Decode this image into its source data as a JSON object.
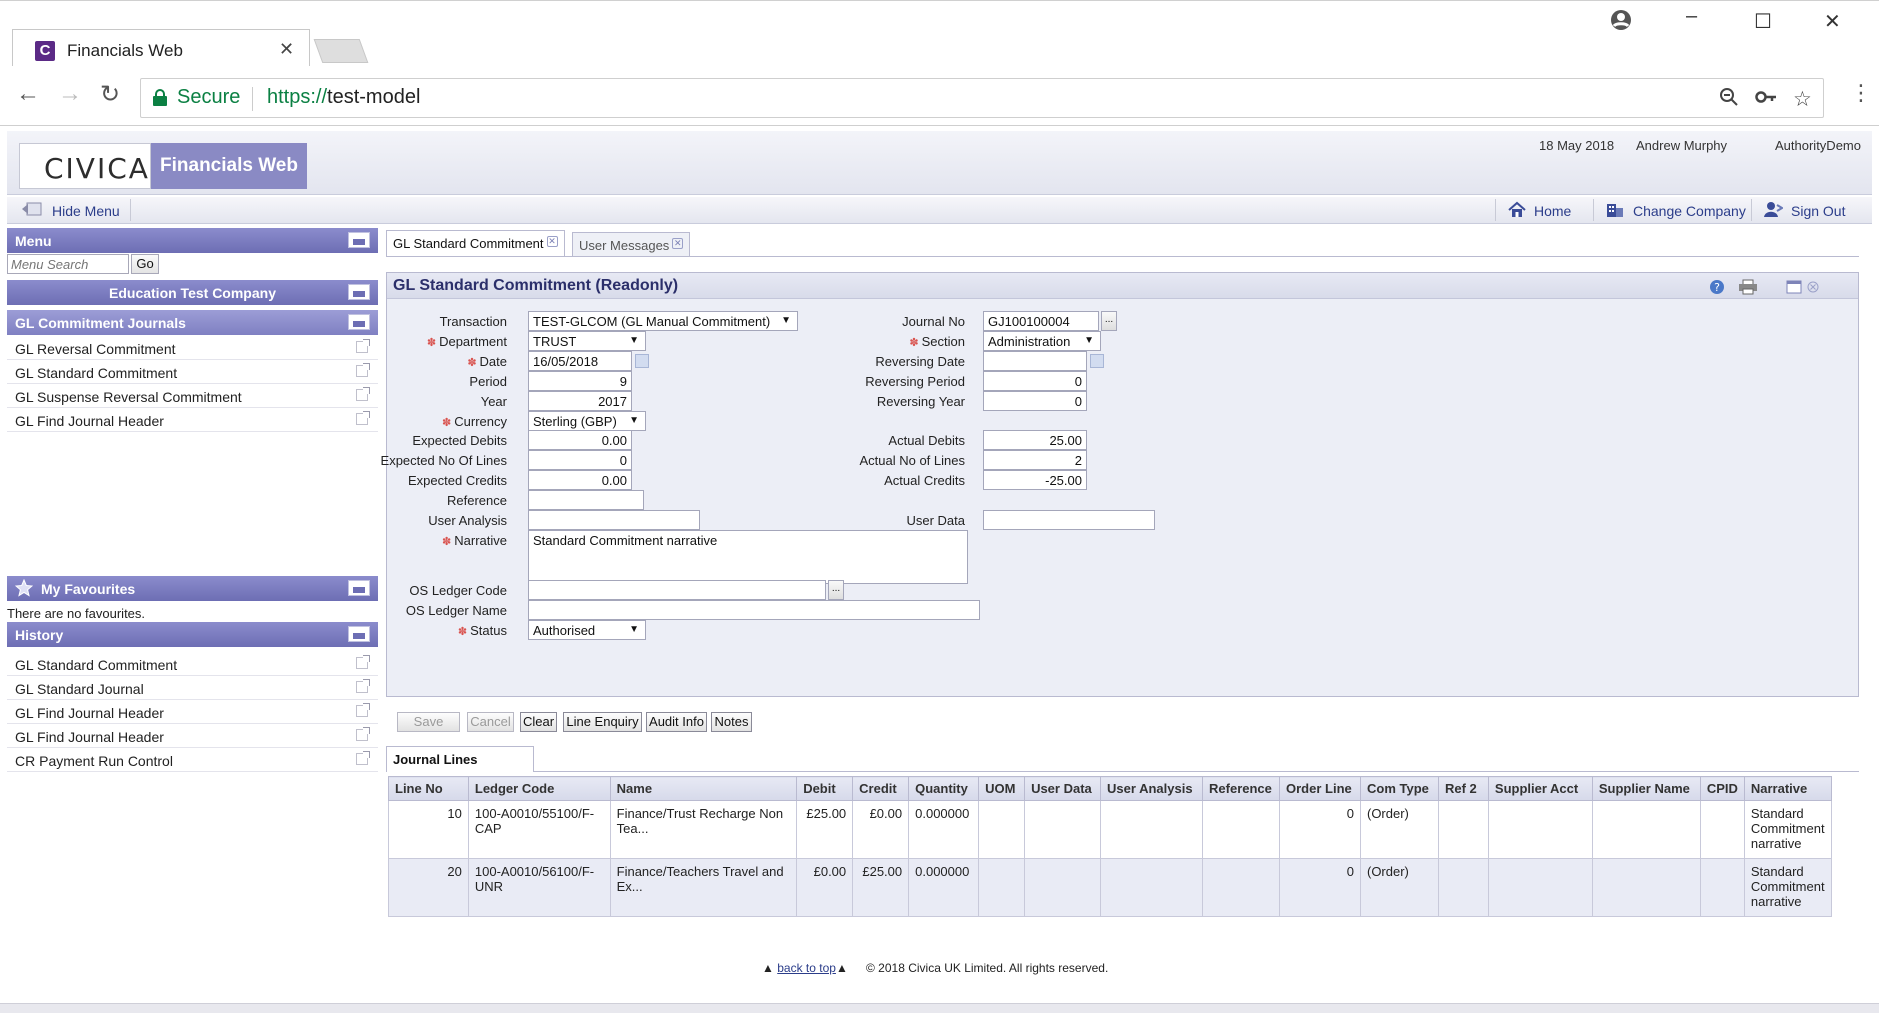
{
  "browser": {
    "tab_title": "Financials Web",
    "secure_label": "Secure",
    "url_scheme": "https://",
    "url_host": "test-model"
  },
  "header": {
    "logo_text": "CIVICA",
    "product_name": "Financials Web",
    "date": "18 May 2018",
    "user": "Andrew Murphy",
    "authority": "AuthorityDemo"
  },
  "menubar": {
    "hide_menu": "Hide Menu",
    "home": "Home",
    "change_company": "Change Company",
    "sign_out": "Sign Out"
  },
  "sidebar": {
    "menu_header": "Menu",
    "search_placeholder": "Menu Search",
    "go_label": "Go",
    "company": "Education Test Company",
    "group_header": "GL Commitment Journals",
    "items": [
      "GL Reversal Commitment",
      "GL Standard Commitment",
      "GL Suspense Reversal Commitment",
      "GL Find Journal Header"
    ],
    "favourites_header": "My Favourites",
    "favourites_empty": "There are no favourites.",
    "history_header": "History",
    "history": [
      "GL Standard Commitment",
      "GL Standard Journal",
      "GL Find Journal Header",
      "GL Find Journal Header",
      "CR Payment Run Control"
    ]
  },
  "tabs": [
    {
      "label": "GL Standard Commitment"
    },
    {
      "label": "User Messages"
    }
  ],
  "form": {
    "title": "GL Standard Commitment (Readonly)",
    "labels": {
      "transaction": "Transaction",
      "department": "Department",
      "date": "Date",
      "period": "Period",
      "year": "Year",
      "currency": "Currency",
      "expected_debits": "Expected Debits",
      "expected_lines": "Expected No Of Lines",
      "expected_credits": "Expected Credits",
      "reference": "Reference",
      "user_analysis": "User Analysis",
      "narrative": "Narrative",
      "os_ledger_code": "OS Ledger Code",
      "os_ledger_name": "OS Ledger Name",
      "status": "Status",
      "journal_no": "Journal No",
      "section": "Section",
      "reversing_date": "Reversing Date",
      "reversing_period": "Reversing Period",
      "reversing_year": "Reversing Year",
      "actual_debits": "Actual Debits",
      "actual_lines": "Actual No of Lines",
      "actual_credits": "Actual Credits",
      "user_data": "User Data"
    },
    "values": {
      "transaction": "TEST-GLCOM (GL Manual Commitment)",
      "department": "TRUST",
      "date": "16/05/2018",
      "period": "9",
      "year": "2017",
      "currency": "Sterling (GBP)",
      "expected_debits": "0.00",
      "expected_lines": "0",
      "expected_credits": "0.00",
      "reference": "",
      "user_analysis": "",
      "narrative": "Standard Commitment narrative",
      "os_ledger_code": "",
      "os_ledger_name": "",
      "status": "Authorised",
      "journal_no": "GJ100100004",
      "section": "Administration",
      "reversing_date": "",
      "reversing_period": "0",
      "reversing_year": "0",
      "actual_debits": "25.00",
      "actual_lines": "2",
      "actual_credits": "-25.00",
      "user_data": ""
    }
  },
  "buttons": {
    "save": "Save",
    "cancel": "Cancel",
    "clear": "Clear",
    "line_enquiry": "Line Enquiry",
    "audit_info": "Audit Info",
    "notes": "Notes"
  },
  "journal_lines": {
    "tab_label": "Journal Lines",
    "columns": [
      "Line No",
      "Ledger Code",
      "Name",
      "Debit",
      "Credit",
      "Quantity",
      "UOM",
      "User Data",
      "User Analysis",
      "Reference",
      "Order Line",
      "Com Type",
      "Ref 2",
      "Supplier Acct",
      "Supplier Name",
      "CPID",
      "Narrative"
    ],
    "rows": [
      [
        "10",
        "100-A0010/55100/F-CAP",
        "Finance/Trust Recharge Non Tea...",
        "£25.00",
        "£0.00",
        "0.000000",
        "",
        "",
        "",
        "",
        "0",
        "(Order)",
        "",
        "",
        "",
        "",
        "Standard Commitment narrative"
      ],
      [
        "20",
        "100-A0010/56100/F-UNR",
        "Finance/Teachers Travel and Ex...",
        "£0.00",
        "£25.00",
        "0.000000",
        "",
        "",
        "",
        "",
        "0",
        "(Order)",
        "",
        "",
        "",
        "",
        "Standard Commitment narrative"
      ]
    ]
  },
  "footer": {
    "back_to_top": "back to top",
    "copyright": "© 2018 Civica UK Limited. All rights reserved."
  }
}
